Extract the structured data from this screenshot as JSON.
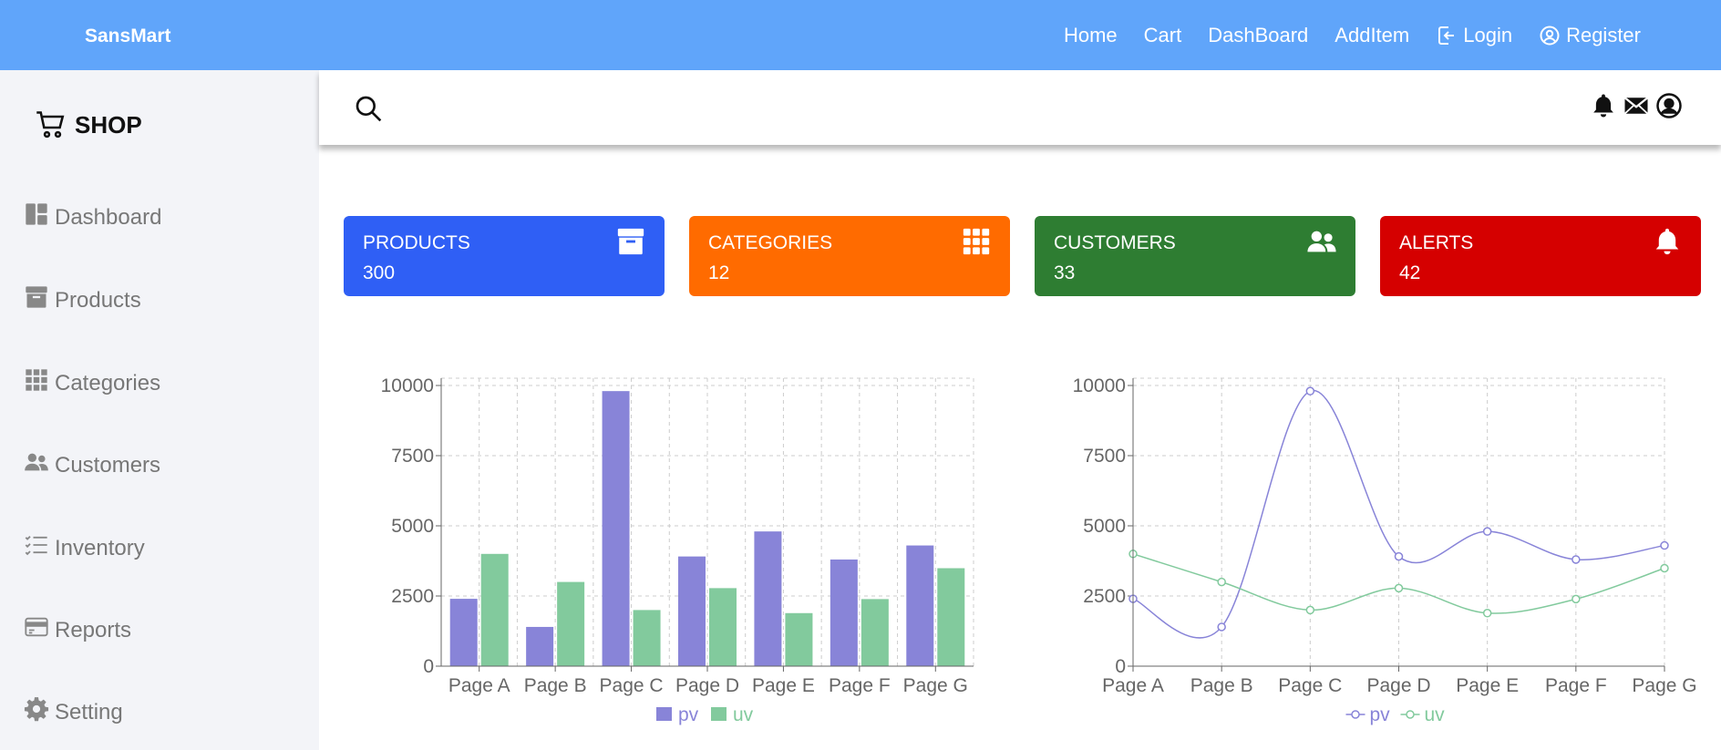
{
  "brand": "SansMart",
  "nav": {
    "home": "Home",
    "cart": "Cart",
    "dashboard": "DashBoard",
    "additem": "AddItem",
    "login": "Login",
    "register": "Register"
  },
  "sidebar": {
    "shop": "SHOP",
    "items": [
      {
        "label": "Dashboard",
        "icon": "dashboard-icon"
      },
      {
        "label": "Products",
        "icon": "archive-icon"
      },
      {
        "label": "Categories",
        "icon": "grid-icon"
      },
      {
        "label": "Customers",
        "icon": "people-icon"
      },
      {
        "label": "Inventory",
        "icon": "list-icon"
      },
      {
        "label": "Reports",
        "icon": "card-icon"
      },
      {
        "label": "Setting",
        "icon": "gear-icon"
      }
    ]
  },
  "cards": [
    {
      "title": "PRODUCTS",
      "value": "300",
      "icon": "archive-icon",
      "color": "#2f5ff5"
    },
    {
      "title": "CATEGORIES",
      "value": "12",
      "icon": "grid-icon",
      "color": "#ff6b00"
    },
    {
      "title": "CUSTOMERS",
      "value": "33",
      "icon": "people-icon",
      "color": "#2e7d32"
    },
    {
      "title": "ALERTS",
      "value": "42",
      "icon": "bell-icon",
      "color": "#d50000"
    }
  ],
  "chart_data": [
    {
      "type": "bar",
      "categories": [
        "Page A",
        "Page B",
        "Page C",
        "Page D",
        "Page E",
        "Page F",
        "Page G"
      ],
      "series": [
        {
          "name": "pv",
          "values": [
            2400,
            1398,
            9800,
            3908,
            4800,
            3800,
            4300
          ],
          "color": "#8884d8"
        },
        {
          "name": "uv",
          "values": [
            4000,
            3000,
            2000,
            2780,
            1890,
            2390,
            3490
          ],
          "color": "#82ca9d"
        }
      ],
      "yticks": [
        "0",
        "2500",
        "5000",
        "7500",
        "10000"
      ],
      "ylim": [
        0,
        10000
      ],
      "grid": true,
      "legend": "bottom"
    },
    {
      "type": "line",
      "categories": [
        "Page A",
        "Page B",
        "Page C",
        "Page D",
        "Page E",
        "Page F",
        "Page G"
      ],
      "series": [
        {
          "name": "pv",
          "values": [
            2400,
            1398,
            9800,
            3908,
            4800,
            3800,
            4300
          ],
          "color": "#8884d8"
        },
        {
          "name": "uv",
          "values": [
            4000,
            3000,
            2000,
            2780,
            1890,
            2390,
            3490
          ],
          "color": "#82ca9d"
        }
      ],
      "yticks": [
        "0",
        "2500",
        "5000",
        "7500",
        "10000"
      ],
      "ylim": [
        0,
        10000
      ],
      "grid": true,
      "legend": "bottom"
    }
  ]
}
